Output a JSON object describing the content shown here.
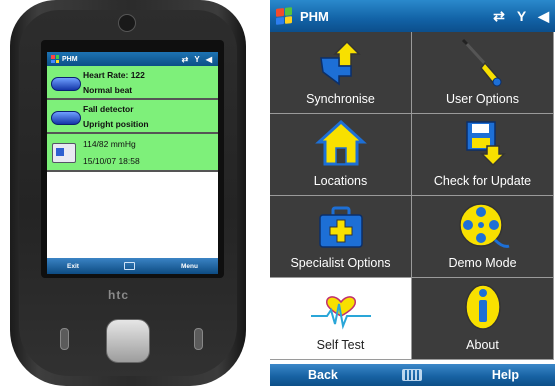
{
  "phone": {
    "screen": {
      "title": "PHM",
      "status_icons": "⇄ Y ◀",
      "rows": [
        {
          "line1": "Heart Rate: 122",
          "line2": "Normal beat"
        },
        {
          "line1": "Fall detector",
          "line2": "Upright position"
        },
        {
          "line1": "114/82 mmHg",
          "line2": "15/10/07 18:58"
        }
      ],
      "menubar": {
        "left": "Exit",
        "right": "Menu"
      }
    },
    "brand": "htc"
  },
  "app": {
    "title": "PHM",
    "status": {
      "sync": "⇄",
      "signal": "Y",
      "volume": "◀"
    },
    "tiles": [
      {
        "label": "Synchronise",
        "icon": "sync-arrows-icon"
      },
      {
        "label": "User Options",
        "icon": "screwdriver-icon"
      },
      {
        "label": "Locations",
        "icon": "house-icon"
      },
      {
        "label": "Check for Update",
        "icon": "floppy-download-icon"
      },
      {
        "label": "Specialist Options",
        "icon": "medical-case-icon"
      },
      {
        "label": "Demo Mode",
        "icon": "film-reel-icon"
      },
      {
        "label": "Self Test",
        "icon": "heart-ecg-icon",
        "selected": true
      },
      {
        "label": "About",
        "icon": "info-icon"
      }
    ],
    "softkeys": {
      "left": "Back",
      "right": "Help"
    }
  },
  "colors": {
    "titlebar": "#1262a6",
    "tile_bg": "#3c3c3c",
    "icon_yellow": "#f8e000",
    "icon_blue": "#1d6fd6",
    "screen_green": "#7ef07a"
  }
}
